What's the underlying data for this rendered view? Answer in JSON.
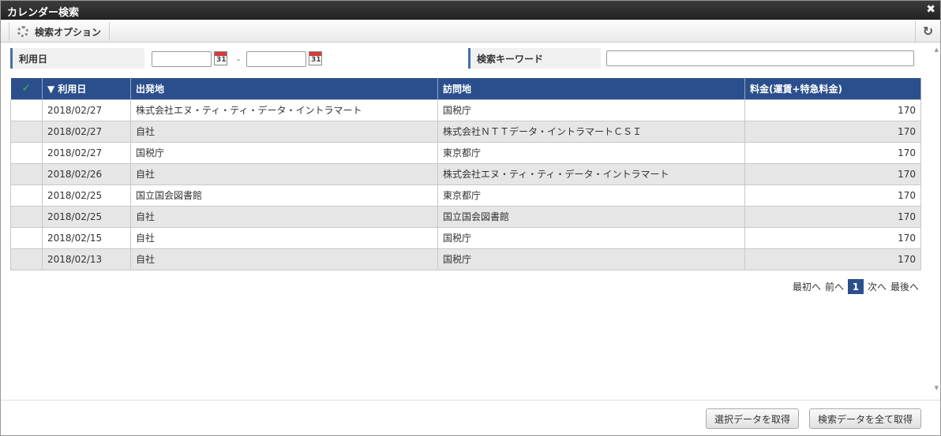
{
  "window": {
    "title": "カレンダー検索",
    "close": "✖"
  },
  "toolbar": {
    "options_label": "検索オプション",
    "refresh": "↻"
  },
  "search": {
    "date_label": "利用日",
    "date_from": "",
    "date_to": "",
    "calendar_glyph": "31",
    "range_sep": "-",
    "keyword_label": "検索キーワード",
    "keyword_value": ""
  },
  "table": {
    "check_header": "✓",
    "columns": [
      "▼ 利用日",
      "出発地",
      "訪問地",
      "料金(運賃+特急料金)"
    ],
    "rows": [
      [
        "2018/02/27",
        "株式会社エヌ・ティ・ティ・データ・イントラマート",
        "国税庁",
        "170"
      ],
      [
        "2018/02/27",
        "自社",
        "株式会社ＮＴＴデータ・イントラマートＣＳＩ",
        "170"
      ],
      [
        "2018/02/27",
        "国税庁",
        "東京都庁",
        "170"
      ],
      [
        "2018/02/26",
        "自社",
        "株式会社エヌ・ティ・ティ・データ・イントラマート",
        "170"
      ],
      [
        "2018/02/25",
        "国立国会図書館",
        "東京都庁",
        "170"
      ],
      [
        "2018/02/25",
        "自社",
        "国立国会図書館",
        "170"
      ],
      [
        "2018/02/15",
        "自社",
        "国税庁",
        "170"
      ],
      [
        "2018/02/13",
        "自社",
        "国税庁",
        "170"
      ]
    ]
  },
  "pager": {
    "first": "最初へ",
    "prev": "前へ",
    "current": "1",
    "next": "次へ",
    "last": "最後へ"
  },
  "buttons": {
    "get_selected": "選択データを取得",
    "get_all": "検索データを全て取得"
  },
  "colors": {
    "header_bg": "#2b4f8c",
    "title_bg": "#2a2a2a",
    "check": "#3ab54a"
  }
}
